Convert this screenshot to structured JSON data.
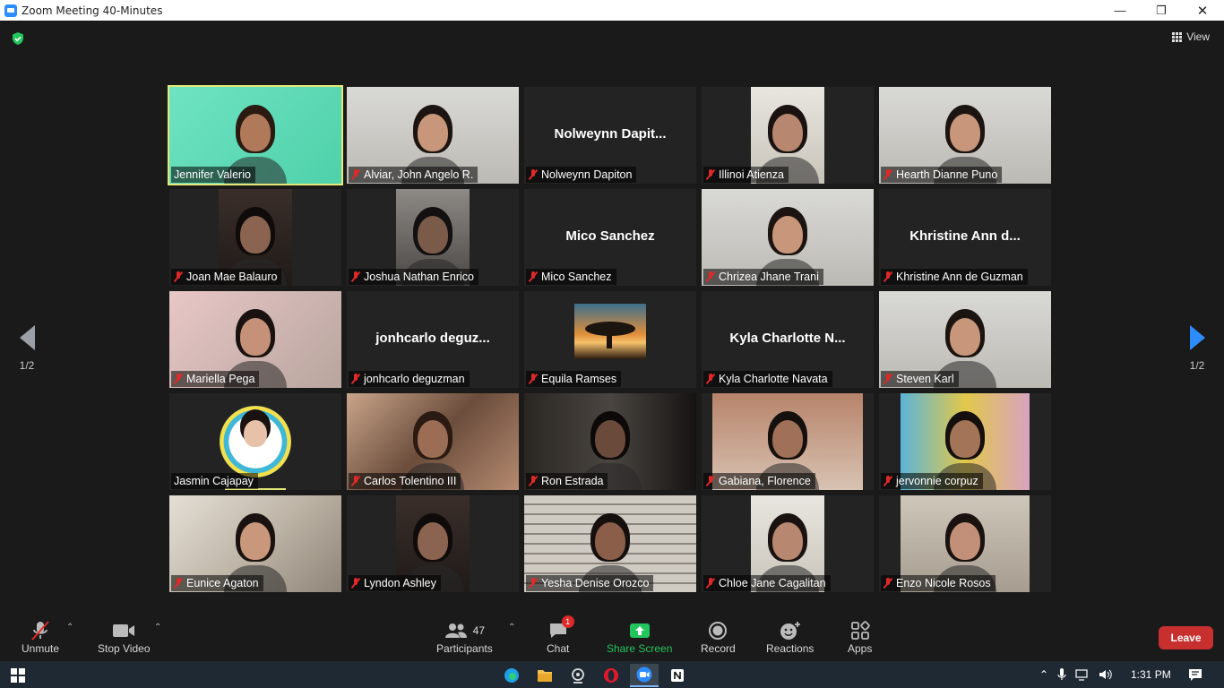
{
  "window": {
    "title": "Zoom Meeting 40-Minutes"
  },
  "header": {
    "view_label": "View"
  },
  "pagination": {
    "left": "1/2",
    "right": "1/2"
  },
  "participants_grid": [
    {
      "name": "Jennifer Valerio",
      "big": "",
      "muted": false,
      "active": true,
      "video": "teacher"
    },
    {
      "name": "Alviar, John Angelo R.",
      "big": "",
      "muted": true,
      "video": "light"
    },
    {
      "name": "Nolweynn Dapiton",
      "big": "Nolweynn  Dapit...",
      "muted": true,
      "video": "none"
    },
    {
      "name": "Illinoi Atienza",
      "big": "",
      "muted": true,
      "video": "narrow-light"
    },
    {
      "name": "Hearth Dianne Puno",
      "big": "",
      "muted": true,
      "video": "light"
    },
    {
      "name": "Joan Mae Balauro",
      "big": "",
      "muted": true,
      "video": "narrow-dark"
    },
    {
      "name": "Joshua Nathan Enrico",
      "big": "",
      "muted": true,
      "video": "narrow-gray"
    },
    {
      "name": "Mico Sanchez",
      "big": "Mico Sanchez",
      "muted": true,
      "video": "none"
    },
    {
      "name": "Chrizea Jhane Trani",
      "big": "",
      "muted": true,
      "video": "light"
    },
    {
      "name": "Khristine Ann de Guzman",
      "big": "Khristine Ann d...",
      "muted": true,
      "video": "none"
    },
    {
      "name": "Mariella Pega",
      "big": "",
      "muted": true,
      "video": "pink"
    },
    {
      "name": "jonhcarlo deguzman",
      "big": "jonhcarlo  deguz...",
      "muted": true,
      "video": "none"
    },
    {
      "name": "Equila Ramses",
      "big": "",
      "muted": true,
      "video": "tree"
    },
    {
      "name": "Kyla Charlotte Navata",
      "big": "Kyla  Charlotte  N...",
      "muted": true,
      "video": "none"
    },
    {
      "name": "Steven Karl",
      "big": "",
      "muted": true,
      "video": "light"
    },
    {
      "name": "Jasmin Cajapay",
      "big": "",
      "muted": false,
      "video": "badge"
    },
    {
      "name": "Carlos Tolentino III",
      "big": "",
      "muted": true,
      "video": "blur-warm"
    },
    {
      "name": "Ron Estrada",
      "big": "",
      "muted": true,
      "video": "dark"
    },
    {
      "name": "Gabiana, Florence",
      "big": "",
      "muted": true,
      "video": "warm"
    },
    {
      "name": "jervonnie corpuz",
      "big": "",
      "muted": true,
      "video": "curtain"
    },
    {
      "name": "Eunice Agaton",
      "big": "",
      "muted": true,
      "video": "blur-light"
    },
    {
      "name": "Lyndon Ashley",
      "big": "",
      "muted": true,
      "video": "narrow-dark"
    },
    {
      "name": "Yesha Denise Orozco",
      "big": "",
      "muted": true,
      "video": "ceiling"
    },
    {
      "name": "Chloe Jane Cagalitan",
      "big": "",
      "muted": true,
      "video": "narrow-light"
    },
    {
      "name": "Enzo Nicole Rosos",
      "big": "",
      "muted": true,
      "video": "bunk"
    }
  ],
  "toolbar": {
    "unmute": "Unmute",
    "stop_video": "Stop Video",
    "participants": "Participants",
    "participants_count": "47",
    "chat": "Chat",
    "chat_badge": "1",
    "share_screen": "Share Screen",
    "record": "Record",
    "reactions": "Reactions",
    "apps": "Apps",
    "leave": "Leave"
  },
  "taskbar": {
    "time": "1:31 PM"
  },
  "colors": {
    "accent": "#2d8cff",
    "share_green": "#22c55e",
    "leave_red": "#c7302f",
    "active_border": "#e5e97a"
  }
}
